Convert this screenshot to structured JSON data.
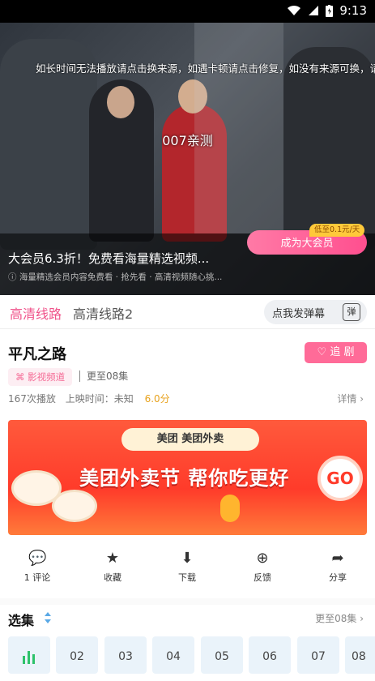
{
  "status_bar": {
    "time": "9:13"
  },
  "player": {
    "hint": "如长时间无法播放请点击换来源，如遇卡顿请点击修复，如没有来源可换，请",
    "subtitle": "007亲测",
    "promo_title": "大会员6.3折！免费看海量精选视频...",
    "promo_sub": "ⓘ 海量精选会员内容免费看 · 抢先看 · 高清视频随心挑...",
    "vip_button": "成为大会员",
    "vip_tag": "低至0.1元/天"
  },
  "lines": {
    "tabs": [
      {
        "label": "高清线路"
      },
      {
        "label": "高清线路2"
      }
    ],
    "danmu_label": "点我发弹幕",
    "danmu_icon": "弹"
  },
  "show": {
    "title": "平凡之路",
    "follow_label": "追 剧",
    "channel_label": "影视频道",
    "update_text": "更至08集",
    "plays": "167次播放",
    "release": "上映时间：未知",
    "score": "6.0分",
    "detail_label": "详情"
  },
  "banner": {
    "logo_text": "美团 美团外卖",
    "slogan": "美团外卖节 帮你吃更好",
    "go": "GO"
  },
  "actions": [
    {
      "label": "1 评论",
      "icon": "comment-icon"
    },
    {
      "label": "收藏",
      "icon": "star-icon"
    },
    {
      "label": "下载",
      "icon": "download-icon"
    },
    {
      "label": "反馈",
      "icon": "feedback-icon"
    },
    {
      "label": "分享",
      "icon": "share-icon"
    }
  ],
  "episodes": {
    "title": "选集",
    "more": "更至08集",
    "items": [
      "",
      "02",
      "03",
      "04",
      "05",
      "06",
      "07",
      "08"
    ]
  },
  "colors": {
    "accent": "#ff6b98",
    "tab_active": "#f0528a",
    "vip_tag": "#ffc93a"
  }
}
